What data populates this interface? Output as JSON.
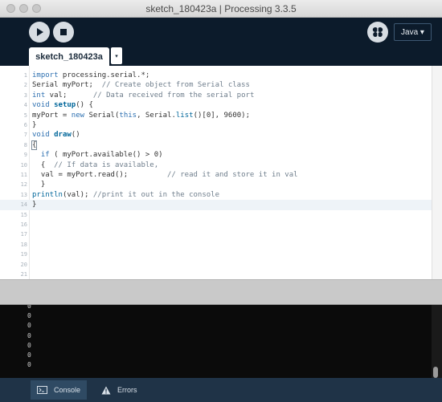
{
  "window": {
    "title": "sketch_180423a | Processing 3.3.5"
  },
  "toolbar": {
    "mode_label": "Java ▾"
  },
  "tabs": {
    "active_label": "sketch_180423a",
    "menu_glyph": "▾"
  },
  "editor": {
    "lines": [
      {
        "n": "1",
        "html": "<span class=\"kw\">import</span> processing.serial.*;"
      },
      {
        "n": "2",
        "html": "Serial myPort;  <span class=\"cm\">// Create object from Serial class</span>"
      },
      {
        "n": "3",
        "html": "<span class=\"kw\">int</span> val;      <span class=\"cm\">// Data received from the serial port</span>"
      },
      {
        "n": "4",
        "html": "<span class=\"kw\">void</span> <span class=\"fn\">setup</span>() {"
      },
      {
        "n": "5",
        "html": "myPort = <span class=\"kw\">new</span> Serial(<span class=\"kw\">this</span>, Serial.<span class=\"fn\" style=\"font-weight:normal\">list</span>()[0], 9600);"
      },
      {
        "n": "6",
        "html": "}"
      },
      {
        "n": "7",
        "html": "<span class=\"kw\">void</span> <span class=\"fn\">draw</span>()"
      },
      {
        "n": "8",
        "html": "<span style=\"outline:1px solid #7a8a99\">{</span>"
      },
      {
        "n": "9",
        "html": "  <span class=\"kw\">if</span> ( myPort.available() > 0)"
      },
      {
        "n": "10",
        "html": "  {  <span class=\"cm\">// If data is available,</span>"
      },
      {
        "n": "11",
        "html": "  val = myPort.read();         <span class=\"cm\">// read it and store it in val</span>"
      },
      {
        "n": "12",
        "html": "  }"
      },
      {
        "n": "13",
        "html": "<span class=\"fn\" style=\"font-weight:normal\">println</span>(val); <span class=\"cm\">//print it out in the console</span>"
      },
      {
        "n": "14",
        "html": "}"
      },
      {
        "n": "15",
        "html": ""
      },
      {
        "n": "16",
        "html": ""
      },
      {
        "n": "17",
        "html": ""
      },
      {
        "n": "18",
        "html": ""
      },
      {
        "n": "19",
        "html": ""
      },
      {
        "n": "20",
        "html": ""
      },
      {
        "n": "21",
        "html": ""
      }
    ],
    "highlighted_line": "14"
  },
  "console": {
    "lines": [
      "0",
      "0",
      "0",
      "0",
      "0",
      "0",
      "0"
    ]
  },
  "bottom_tabs": {
    "console_label": "Console",
    "errors_label": "Errors"
  },
  "colors": {
    "chrome": "#0c1b2b",
    "bottom_bar": "#1f3347",
    "keyword": "#2c6fb0"
  },
  "icons": {
    "run": "play-icon",
    "stop": "stop-icon",
    "debug": "butterfly-debug-icon",
    "console": "terminal-icon",
    "errors": "warning-icon"
  }
}
